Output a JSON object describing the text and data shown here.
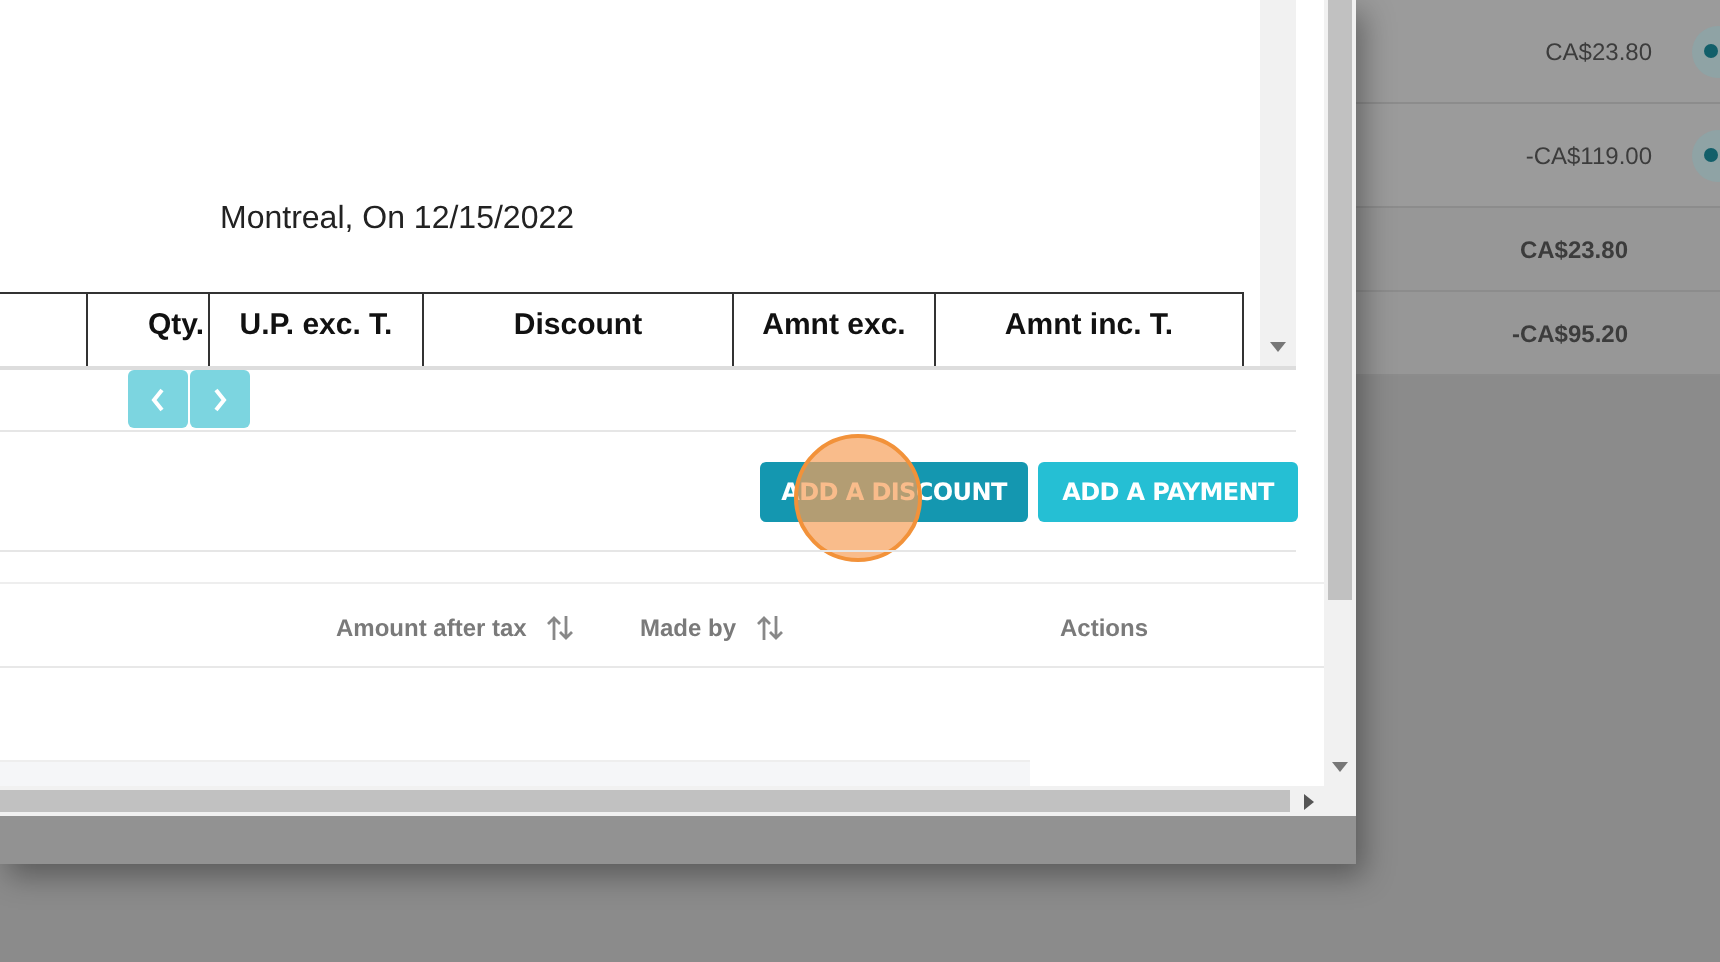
{
  "background_rows": [
    {
      "amount": "CA$23.80",
      "bold": false,
      "has_view_icon": true
    },
    {
      "amount": "-CA$119.00",
      "bold": false,
      "has_view_icon": true
    },
    {
      "amount": "CA$23.80",
      "bold": true,
      "has_view_icon": false
    },
    {
      "amount": "-CA$95.20",
      "bold": true,
      "has_view_icon": false
    }
  ],
  "document": {
    "place_date": "Montreal, On 12/15/2022",
    "columns": [
      "Qty.",
      "U.P. exc. T.",
      "Discount",
      "Amnt exc.",
      "Amnt inc. T."
    ]
  },
  "buttons": [
    {
      "label": "ADD A DISCOUNT",
      "kind": "dark",
      "click_highlighted": true
    },
    {
      "label": "ADD A PAYMENT",
      "kind": "light",
      "click_highlighted": false
    }
  ],
  "payments_table": {
    "columns": [
      {
        "label": "Amount after tax",
        "sortable": true
      },
      {
        "label": "Made by",
        "sortable": true
      },
      {
        "label": "Actions",
        "sortable": false
      }
    ]
  }
}
